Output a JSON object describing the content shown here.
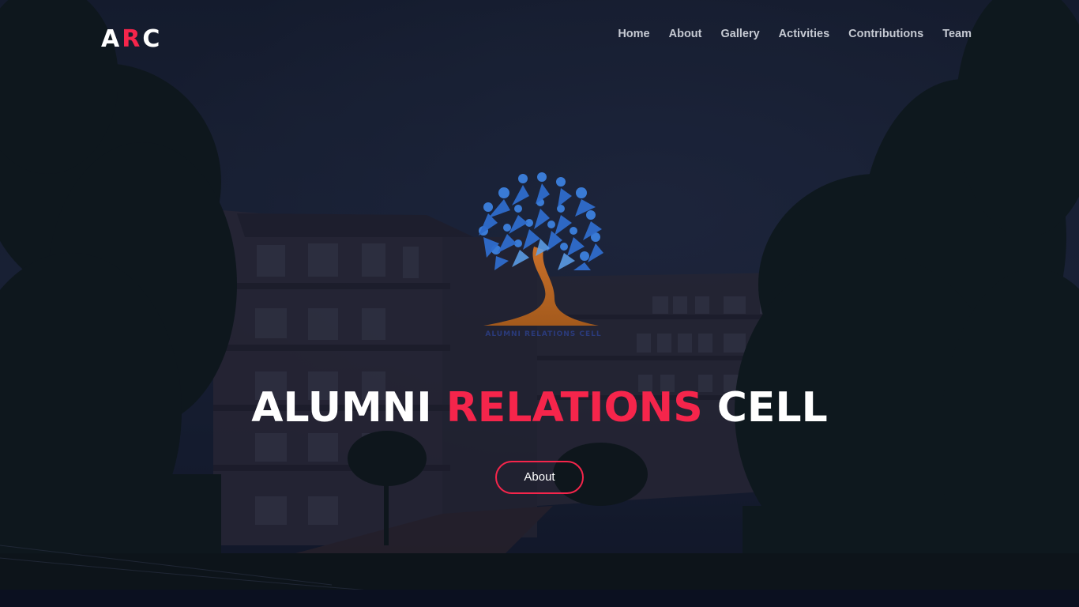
{
  "brand": {
    "letter_1": "A",
    "letter_2": "R",
    "letter_3": "C"
  },
  "nav": {
    "items": [
      {
        "label": "Home"
      },
      {
        "label": "About"
      },
      {
        "label": "Gallery"
      },
      {
        "label": "Activities"
      },
      {
        "label": "Contributions"
      },
      {
        "label": "Team"
      }
    ]
  },
  "hero": {
    "title_part_1": "ALUMNI",
    "title_part_2": "RELATIONS",
    "title_part_3": "CELL",
    "emblem_caption": "ALUMNI RELATIONS CELL",
    "button_label": "About"
  },
  "colors": {
    "accent": "#f5254b",
    "overlay": "#0d1326",
    "nav_text": "#c6cad3"
  }
}
